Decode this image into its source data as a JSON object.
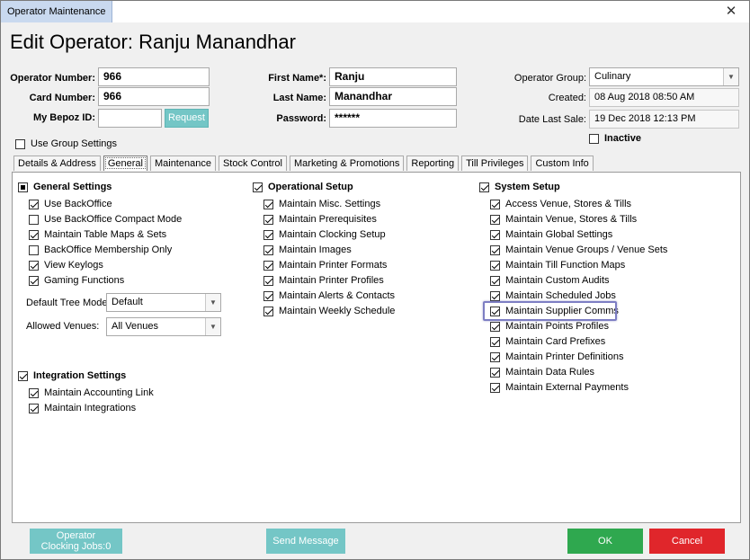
{
  "window": {
    "title": "Operator Maintenance",
    "close_glyph": "✕"
  },
  "page_title": "Edit Operator: Ranju Manandhar",
  "form": {
    "operator_number_label": "Operator Number:",
    "operator_number": "966",
    "card_number_label": "Card Number:",
    "card_number": "966",
    "bepoz_id_label": "My Bepoz ID:",
    "bepoz_id": "",
    "request_button": "Request",
    "first_name_label": "First Name*:",
    "first_name": "Ranju",
    "last_name_label": "Last Name:",
    "last_name": "Manandhar",
    "password_label": "Password:",
    "password": "******",
    "operator_group_label": "Operator Group:",
    "operator_group": "Culinary",
    "created_label": "Created:",
    "created": "08 Aug 2018 08:50 AM",
    "date_last_sale_label": "Date Last Sale:",
    "date_last_sale": "19 Dec 2018 12:13 PM",
    "inactive_label": "Inactive",
    "use_group_settings_label": "Use Group Settings"
  },
  "tabs": [
    "Details & Address",
    "General",
    "Maintenance",
    "Stock Control",
    "Marketing & Promotions",
    "Reporting",
    "Till Privileges",
    "Custom Info"
  ],
  "general": {
    "general_settings": {
      "title": "General Settings",
      "items": [
        "Use BackOffice",
        "Use BackOffice Compact Mode",
        "Maintain Table Maps & Sets",
        "BackOffice Membership Only",
        "View Keylogs",
        "Gaming Functions"
      ],
      "checked": [
        true,
        false,
        true,
        false,
        true,
        true
      ]
    },
    "default_tree_mode_label": "Default Tree Mode:",
    "default_tree_mode": "Default",
    "allowed_venues_label": "Allowed Venues:",
    "allowed_venues": "All Venues",
    "integration_settings": {
      "title": "Integration Settings",
      "items": [
        "Maintain Accounting Link",
        "Maintain Integrations"
      ]
    },
    "operational_setup": {
      "title": "Operational Setup",
      "items": [
        "Maintain Misc. Settings",
        "Maintain Prerequisites",
        "Maintain Clocking Setup",
        "Maintain Images",
        "Maintain Printer Formats",
        "Maintain Printer Profiles",
        "Maintain Alerts & Contacts",
        "Maintain Weekly Schedule"
      ]
    },
    "system_setup": {
      "title": "System Setup",
      "items": [
        "Access Venue, Stores & Tills",
        "Maintain Venue, Stores & Tills",
        "Maintain Global Settings",
        "Maintain Venue Groups / Venue Sets",
        "Maintain Till Function Maps",
        "Maintain Custom Audits",
        "Maintain Scheduled Jobs",
        "Maintain Supplier Comms",
        "Maintain Points Profiles",
        "Maintain Card Prefixes",
        "Maintain Printer Definitions",
        "Maintain Data Rules",
        "Maintain External Payments"
      ]
    }
  },
  "footer": {
    "clocking_line1": "Operator",
    "clocking_line2": "Clocking Jobs:0",
    "send_message": "Send Message",
    "ok": "OK",
    "cancel": "Cancel"
  },
  "colors": {
    "teal": "#74c6c6",
    "ok_green": "#2fa84f",
    "cancel_red": "#e0262b",
    "highlight": "#7d7ec3"
  }
}
